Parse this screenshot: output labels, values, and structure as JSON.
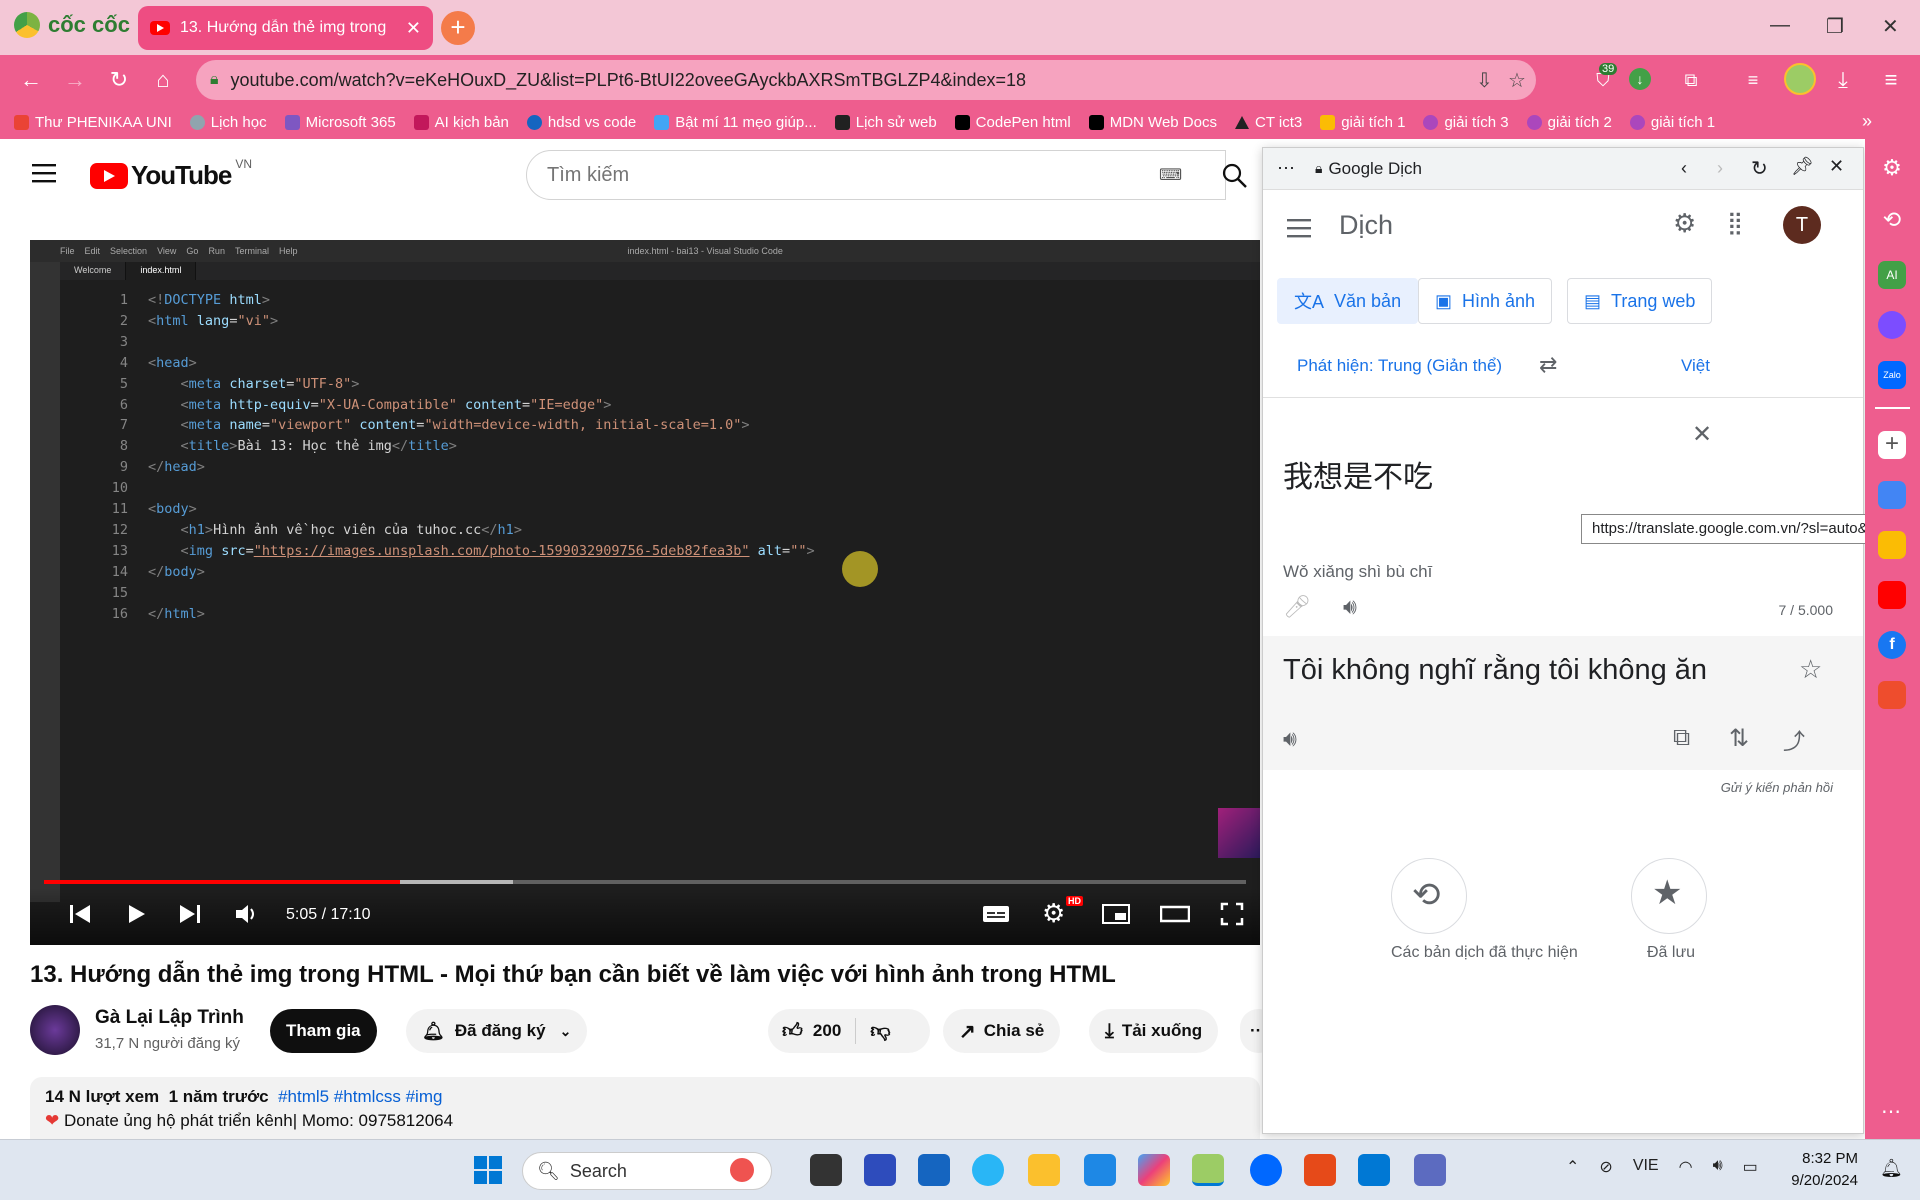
{
  "browser": {
    "brand": "cốc cốc",
    "tab_title": "13. Hướng dẫn thẻ img trong",
    "url": "youtube.com/watch?v=eKeHOuxD_ZU&list=PLPt6-BtUI22oveeGAyckbAXRSmTBGLZP4&index=18",
    "ext_badge": "39",
    "bookmarks": [
      "Thư PHENIKAA UNI",
      "Lịch học",
      "Microsoft 365",
      "AI kịch bản",
      "hdsd vs code",
      "Bật mí 11 mẹo giúp...",
      "Lịch sử web",
      "CodePen html",
      "MDN Web Docs",
      "CT ict3",
      "giải tích 1",
      "giải tích 3",
      "giải tích 2",
      "giải tích 1"
    ]
  },
  "youtube": {
    "logo": "YouTube",
    "region": "VN",
    "search_placeholder": "Tìm kiếm",
    "video": {
      "time": "5:05 / 17:10",
      "progress_fraction": 0.296,
      "buffered_fraction": 0.39,
      "hd_badge": "HD",
      "vscode_tabs": [
        "Welcome",
        "index.html"
      ],
      "vscode_menu": [
        "File",
        "Edit",
        "Selection",
        "View",
        "Go",
        "Run",
        "Terminal",
        "Help"
      ],
      "vscode_title": "index.html - bai13 - Visual Studio Code"
    },
    "title": "13. Hướng dẫn thẻ img trong HTML - Mọi thứ bạn cần biết về làm việc với hình ảnh trong HTML",
    "channel": {
      "name": "Gà Lại Lập Trình",
      "subs": "31,7 N người đăng ký"
    },
    "buttons": {
      "join": "Tham gia",
      "subscribed": "Đã đăng ký",
      "likes": "200",
      "share": "Chia sẻ",
      "download": "Tải xuống",
      "more": "···"
    },
    "description": {
      "views": "14 N lượt xem",
      "age": "1 năm trước",
      "tags": "#html5 #htmlcss #img",
      "line2": "Donate ủng hộ phát triển kênh| Momo: 0975812064"
    }
  },
  "translate": {
    "header_title": "Google Dịch",
    "app_title": "Dịch",
    "avatar": "T",
    "modes": [
      "Văn bản",
      "Hình ảnh",
      "Trang web"
    ],
    "source_lang": "Phát hiện: Trung (Giản thể)",
    "target_lang": "Việt",
    "source_text": "我想是不吃",
    "pinyin": "Wǒ xiǎng shì bù chī",
    "char_count": "7 / 5.000",
    "translation": "Tôi không nghĩ rằng tôi không ăn",
    "feedback": "Gửi ý kiến phản hồi",
    "history_label": "Các bản dịch đã thực hiện",
    "saved_label": "Đã lưu",
    "tooltip": "https://translate.google.com.vn/?sl=auto&tl=v..."
  },
  "taskbar": {
    "search": "Search",
    "lang": "VIE",
    "time": "8:32 PM",
    "date": "9/20/2024"
  }
}
